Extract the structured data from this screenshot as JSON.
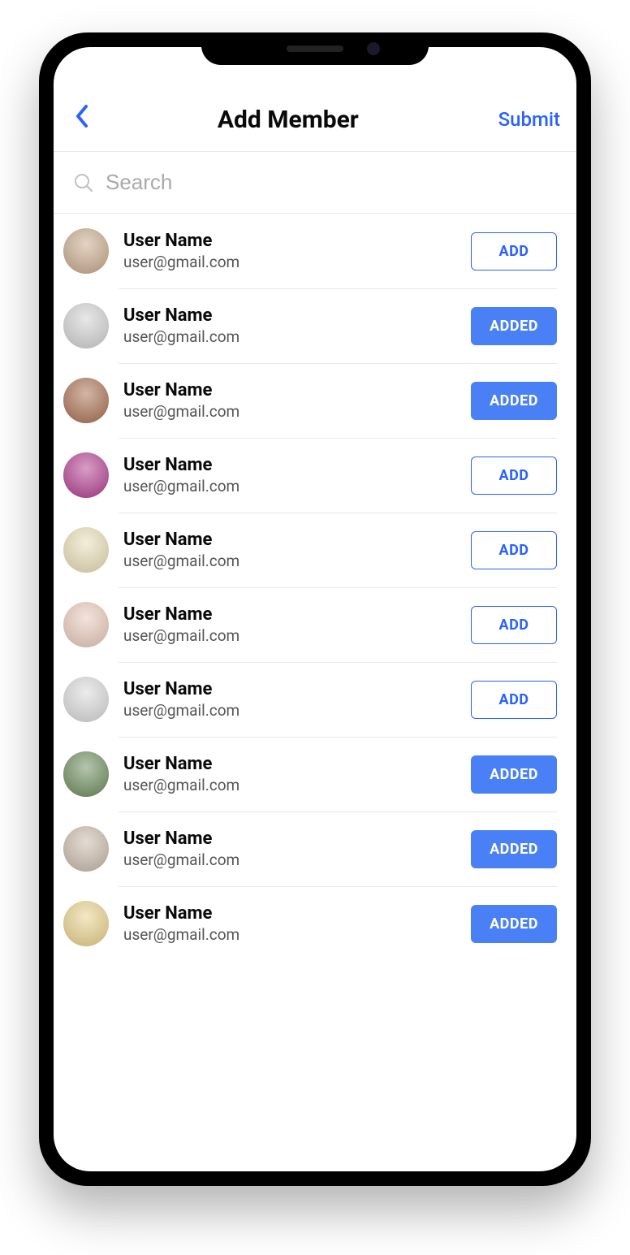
{
  "header": {
    "title": "Add Member",
    "submit_label": "Submit"
  },
  "search": {
    "placeholder": "Search"
  },
  "labels": {
    "add": "ADD",
    "added": "ADDED"
  },
  "members": [
    {
      "name": "User Name",
      "email": "user@gmail.com",
      "added": false,
      "avatar_bg": "#c7a889"
    },
    {
      "name": "User Name",
      "email": "user@gmail.com",
      "added": true,
      "avatar_bg": "#d0d0d0"
    },
    {
      "name": "User Name",
      "email": "user@gmail.com",
      "added": true,
      "avatar_bg": "#a86d4e"
    },
    {
      "name": "User Name",
      "email": "user@gmail.com",
      "added": false,
      "avatar_bg": "#b23a8e"
    },
    {
      "name": "User Name",
      "email": "user@gmail.com",
      "added": false,
      "avatar_bg": "#e8dcb5"
    },
    {
      "name": "User Name",
      "email": "user@gmail.com",
      "added": false,
      "avatar_bg": "#e8c8b8"
    },
    {
      "name": "User Name",
      "email": "user@gmail.com",
      "added": false,
      "avatar_bg": "#d8d8d8"
    },
    {
      "name": "User Name",
      "email": "user@gmail.com",
      "added": true,
      "avatar_bg": "#6a8a5a"
    },
    {
      "name": "User Name",
      "email": "user@gmail.com",
      "added": true,
      "avatar_bg": "#c8b8a8"
    },
    {
      "name": "User Name",
      "email": "user@gmail.com",
      "added": true,
      "avatar_bg": "#e8d088"
    }
  ]
}
